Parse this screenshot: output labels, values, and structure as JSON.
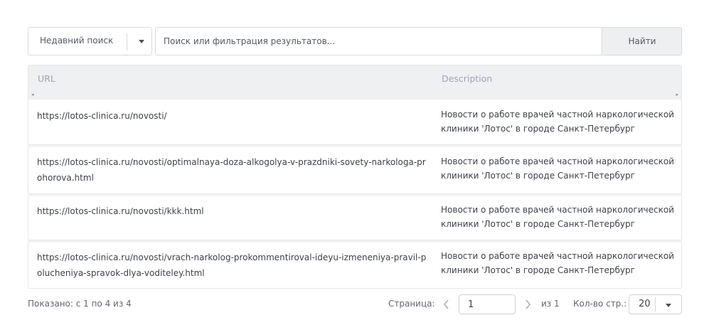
{
  "search": {
    "recent_label": "Недавний поиск",
    "placeholder": "Поиск или фильтрация результатов...",
    "button_label": "Найти"
  },
  "table": {
    "columns": [
      "URL",
      "Description"
    ],
    "rows": [
      {
        "url": "https://lotos-clinica.ru/novosti/",
        "description": "Новости о работе врачей частной наркологической клиники 'Лотос' в городе Санкт-Петербург"
      },
      {
        "url": "https://lotos-clinica.ru/novosti/optimalnaya-doza-alkogolya-v-prazdniki-sovety-narkologa-prohorova.html",
        "description": "Новости о работе врачей частной наркологической клиники 'Лотос' в городе Санкт-Петербург"
      },
      {
        "url": "https://lotos-clinica.ru/novosti/kkk.html",
        "description": "Новости о работе врачей частной наркологической клиники 'Лотос' в городе Санкт-Петербург"
      },
      {
        "url": "https://lotos-clinica.ru/novosti/vrach-narkolog-prokommentiroval-ideyu-izmeneniya-pravil-polucheniya-spravok-dlya-voditeley.html",
        "description": "Новости о работе врачей частной наркологической клиники 'Лотос' в городе Санкт-Петербург"
      }
    ]
  },
  "footer": {
    "shown_text": "Показано: с 1 по 4 из 4",
    "page_label": "Страница:",
    "page_value": "1",
    "of_total": "из 1",
    "per_page_label": "Кол-во стр.:",
    "per_page_value": "20"
  },
  "icons": {
    "recent_caret": "caret-down-icon",
    "prev": "chevron-left-icon",
    "next": "chevron-right-icon",
    "per_page_caret": "caret-down-icon"
  }
}
